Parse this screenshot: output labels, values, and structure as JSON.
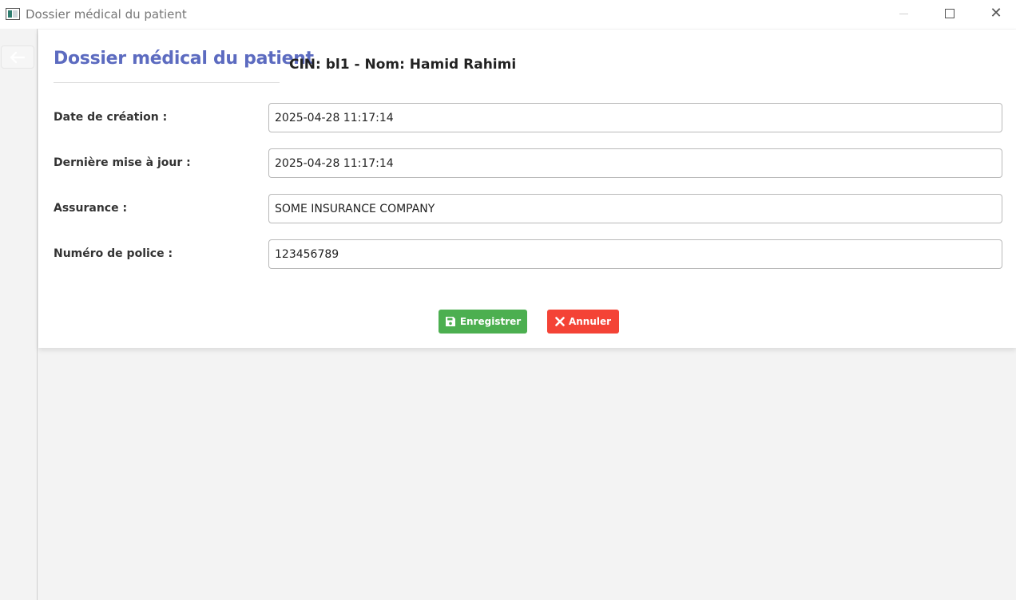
{
  "window": {
    "title": "Dossier médical du patient",
    "icons": {
      "app": "app-window-icon",
      "minimize": "minimize-icon",
      "maximize": "maximize-icon",
      "close": "close-icon"
    },
    "close_glyph": "✕"
  },
  "nav": {
    "back_icon": "arrow-left-icon"
  },
  "header": {
    "title": "Dossier médical du patient",
    "patient_info": "CIN: bl1 - Nom: Hamid Rahimi"
  },
  "form": {
    "fields": [
      {
        "label": "Date de création :",
        "value": "2025-04-28 11:17:14"
      },
      {
        "label": "Dernière mise à jour :",
        "value": "2025-04-28 11:17:14"
      },
      {
        "label": "Assurance :",
        "value": "SOME INSURANCE COMPANY"
      },
      {
        "label": "Numéro de police :",
        "value": "123456789"
      }
    ]
  },
  "actions": {
    "save_label": "Enregistrer",
    "save_icon": "floppy-disk-icon",
    "cancel_label": "Annuler",
    "cancel_icon": "x-icon"
  },
  "colors": {
    "title_accent": "#5c6bc0",
    "save_button": "#4caf50",
    "cancel_button": "#f44336",
    "background": "#f3f3f3",
    "card": "#ffffff"
  }
}
